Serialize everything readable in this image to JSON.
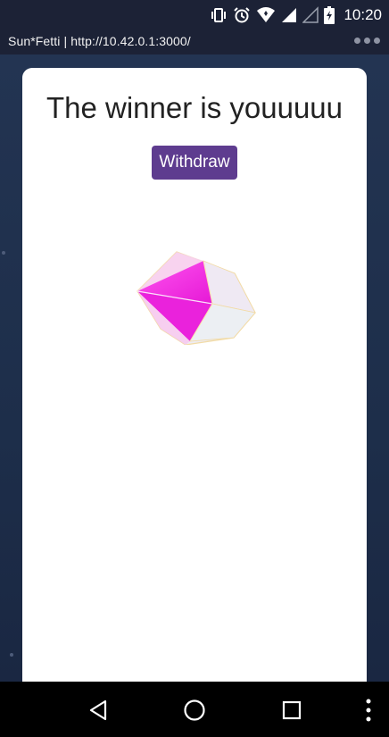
{
  "status_bar": {
    "time": "10:20",
    "icons": [
      "vibrate-icon",
      "alarm-icon",
      "wifi-icon",
      "signal-icon",
      "signal-empty-icon",
      "battery-charging-icon"
    ]
  },
  "app_header": {
    "title": "Sun*Fetti | http://10.42.0.1:3000/",
    "menu_icon": "more-dots-icon"
  },
  "card": {
    "heading": "The winner is youuuuu",
    "withdraw_label": "Withdraw",
    "gem_icon": "gem-icon"
  },
  "colors": {
    "button_bg": "#5e3c8f",
    "gem_magenta": "#ff33ee",
    "page_bg": "#1e2a44"
  },
  "nav_bar": {
    "icons": [
      "back-icon",
      "home-icon",
      "recents-icon",
      "more-vert-icon"
    ]
  }
}
